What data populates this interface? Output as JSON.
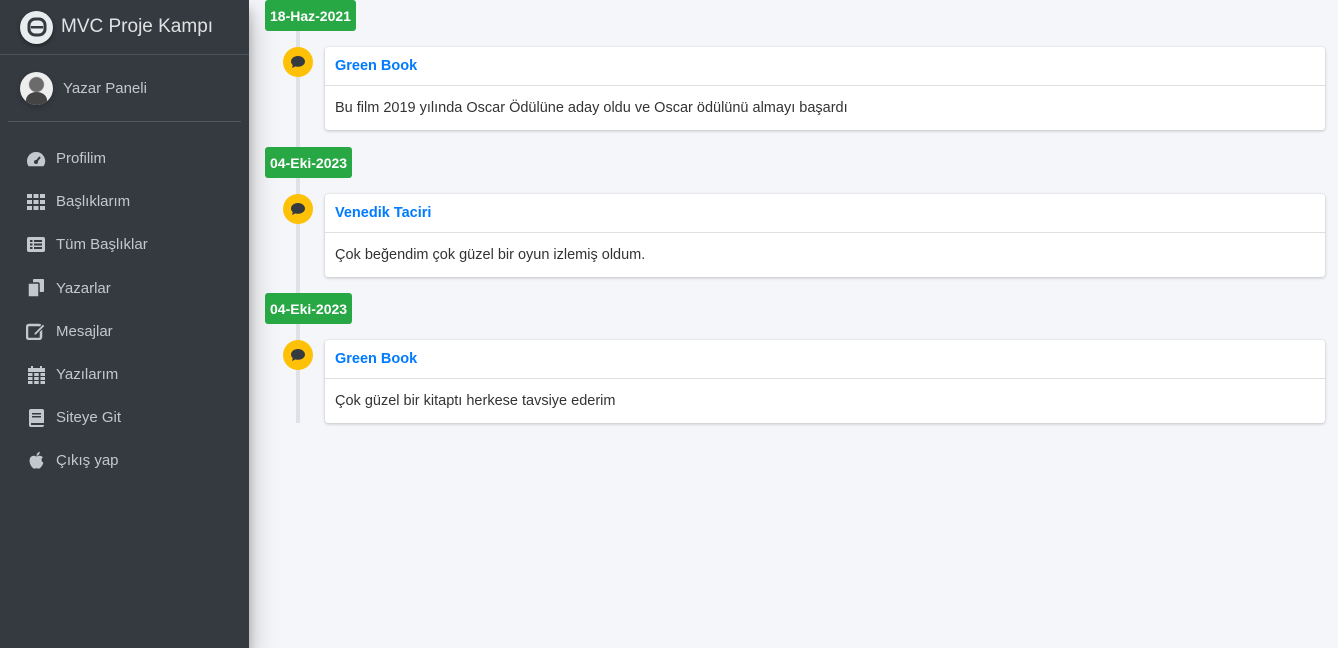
{
  "brand": {
    "title": "MVC Proje Kampı"
  },
  "user": {
    "name": "Yazar Paneli"
  },
  "sidebar": {
    "items": [
      {
        "label": "Profilim",
        "icon": "tachometer-icon"
      },
      {
        "label": "Başlıklarım",
        "icon": "grid-icon"
      },
      {
        "label": "Tüm Başlıklar",
        "icon": "list-icon"
      },
      {
        "label": "Yazarlar",
        "icon": "copy-icon"
      },
      {
        "label": "Mesajlar",
        "icon": "edit-icon"
      },
      {
        "label": "Yazılarım",
        "icon": "calendar-icon"
      },
      {
        "label": "Siteye Git",
        "icon": "book-icon"
      },
      {
        "label": "Çıkış yap",
        "icon": "apple-icon"
      }
    ]
  },
  "timeline": [
    {
      "date": "18-Haz-2021",
      "title": "Green Book",
      "body": "Bu film 2019 yılında Oscar Ödülüne aday oldu ve Oscar ödülünü almayı başardı"
    },
    {
      "date": "04-Eki-2023",
      "title": "Venedik Taciri",
      "body": "Çok beğendim çok güzel bir oyun izlemiş oldum."
    },
    {
      "date": "04-Eki-2023",
      "title": "Green Book",
      "body": "Çok güzel bir kitaptı herkese tavsiye ederim"
    }
  ],
  "colors": {
    "sidebar_bg": "#343a40",
    "date_label": "#28a745",
    "icon_bg": "#ffc107",
    "link": "#007bff"
  }
}
